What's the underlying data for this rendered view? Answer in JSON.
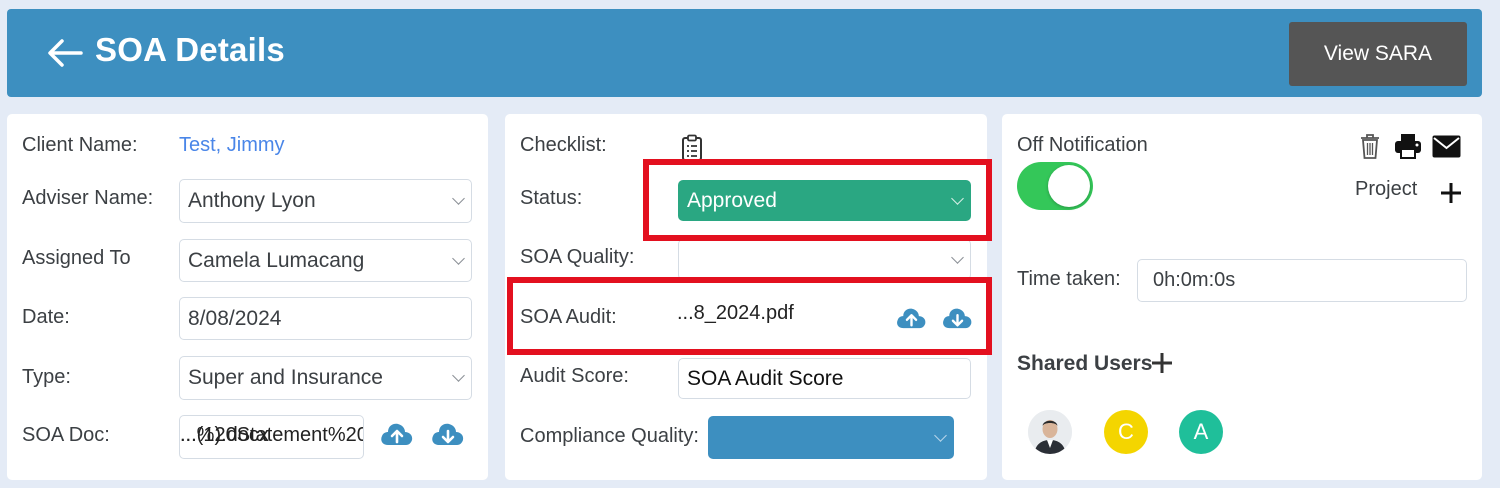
{
  "header": {
    "title": "SOA Details",
    "view_sara_label": "View SARA"
  },
  "left": {
    "client_name_label": "Client Name:",
    "client_name_value": "Test, Jimmy",
    "adviser_name_label": "Adviser Name:",
    "adviser_name_value": "Anthony Lyon",
    "assigned_to_label": "Assigned To",
    "assigned_to_value": "Camela Lumacang",
    "date_label": "Date:",
    "date_value": "8/08/2024",
    "type_label": "Type:",
    "type_value": "Super and Insurance",
    "soa_doc_label": "SOA Doc:",
    "soa_doc_value_a": "...%20Statement%20",
    "soa_doc_value_b": "...(1).docx"
  },
  "middle": {
    "checklist_label": "Checklist:",
    "status_label": "Status:",
    "status_value": "Approved",
    "soa_quality_label": "SOA Quality:",
    "soa_quality_value": "",
    "soa_audit_label": "SOA Audit:",
    "soa_audit_value": "...8_2024.pdf",
    "audit_score_label": "Audit Score:",
    "audit_score_value": "SOA Audit Score",
    "compliance_quality_label": "Compliance Quality:",
    "compliance_quality_value": ""
  },
  "right": {
    "off_notification_label": "Off Notification",
    "notification_on": true,
    "project_label": "Project",
    "time_taken_label": "Time taken:",
    "time_taken_value": "0h:0m:0s",
    "shared_users_label": "Shared Users",
    "users": [
      {
        "initial": "",
        "color": "#e9ecef"
      },
      {
        "initial": "C",
        "color": "#f4d500"
      },
      {
        "initial": "A",
        "color": "#1fbf9a"
      }
    ]
  },
  "colors": {
    "header": "#3d8fc0",
    "status_approved": "#2aa782",
    "highlight": "#e3101f",
    "compliance_select": "#3d8fc0"
  },
  "icons": [
    "back-arrow-icon",
    "clipboard-icon",
    "upload-cloud-icon",
    "download-cloud-icon",
    "trash-icon",
    "print-icon",
    "mail-icon",
    "plus-icon"
  ]
}
